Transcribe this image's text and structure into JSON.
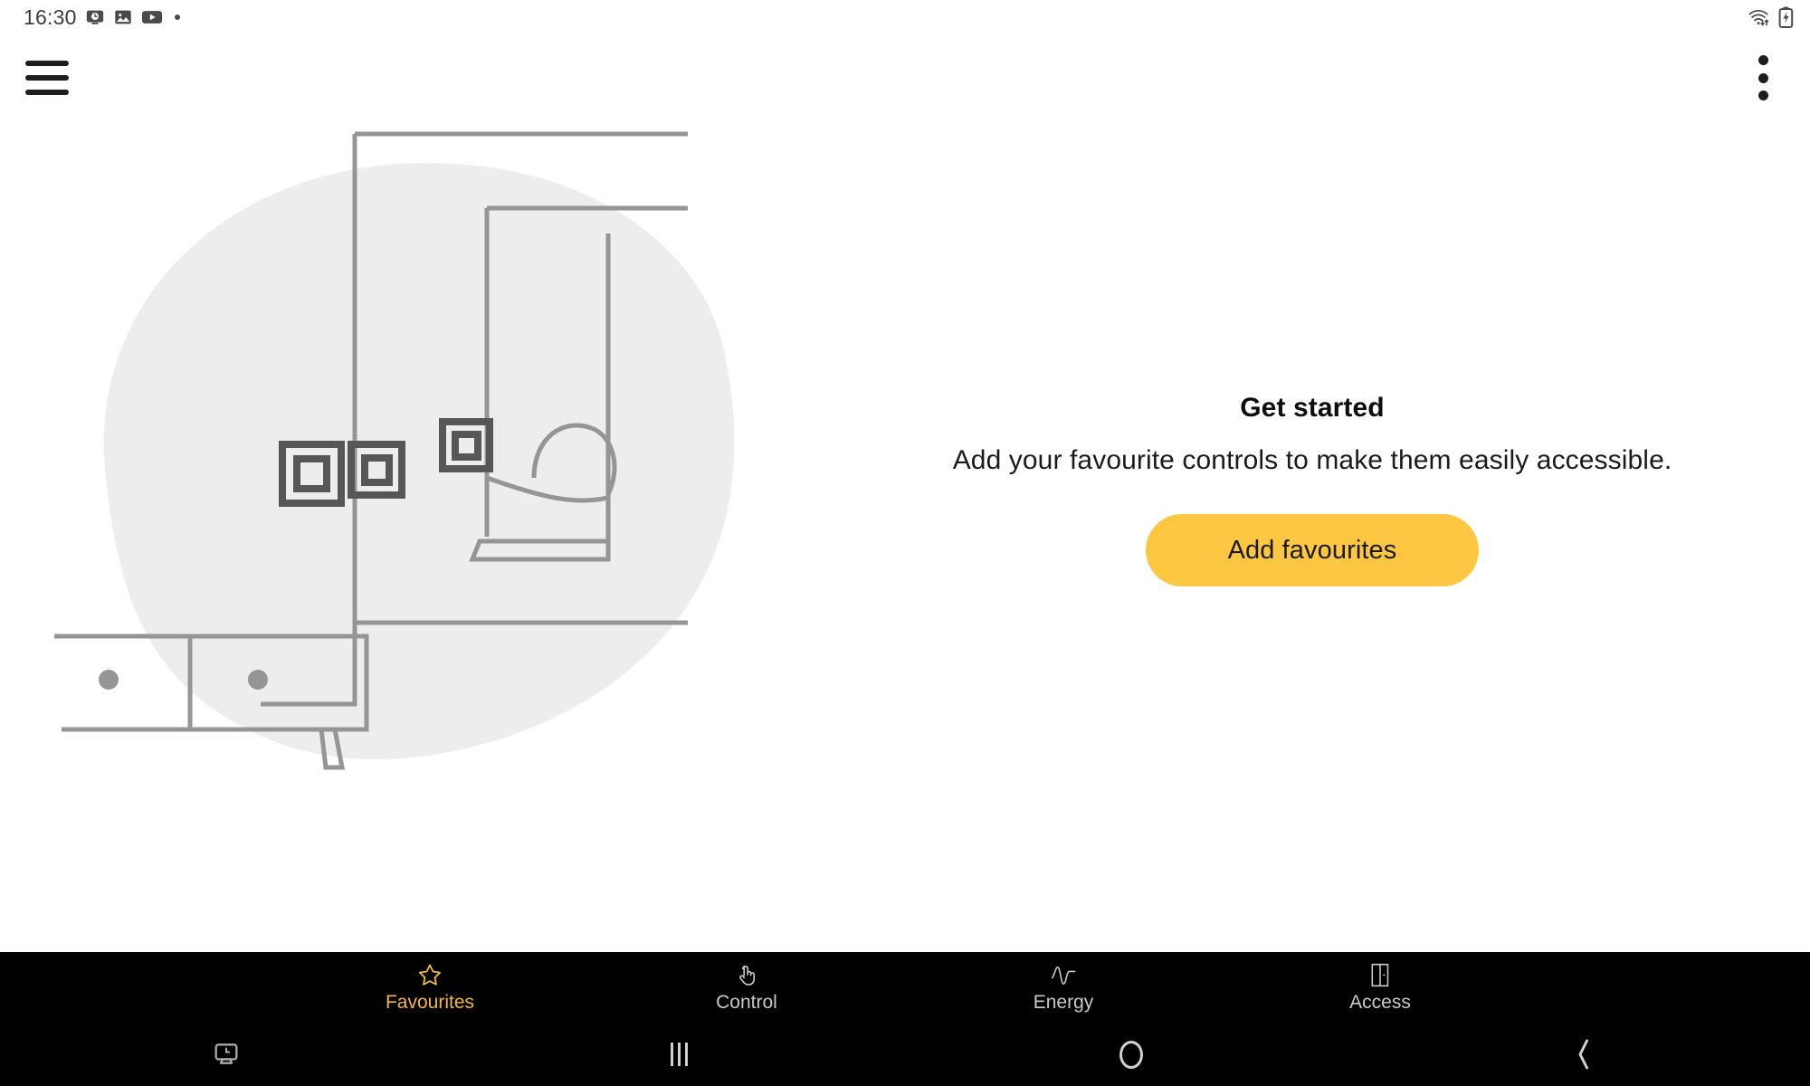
{
  "status_bar": {
    "clock": "16:30",
    "left_icons": [
      {
        "name": "screen-recorder-icon",
        "glyph": "screen-clock"
      },
      {
        "name": "gallery-icon",
        "glyph": "image"
      },
      {
        "name": "youtube-icon",
        "glyph": "play"
      },
      {
        "name": "more-notifications-dot",
        "glyph": "dot"
      }
    ],
    "right_icons": [
      {
        "name": "wifi-transfer-icon",
        "glyph": "wifi-arrows"
      },
      {
        "name": "battery-charging-icon",
        "glyph": "battery-bolt"
      }
    ]
  },
  "app_bar": {
    "menu_label": "Menu",
    "overflow_label": "More options"
  },
  "illustration": {
    "name": "empty-favourites-room-illustration",
    "description": "Line-art room with wall switches, a window showing sun over hills, and a sideboard",
    "blob_color": "#ededed",
    "line_color": "#959595",
    "switch_color": "#575757"
  },
  "main": {
    "title": "Get started",
    "subtitle": "Add your favourite controls to make them easily accessible.",
    "button_label": "Add favourites",
    "button_color": "#fdc741",
    "button_text_color": "#1a1a1a"
  },
  "bottom_nav": {
    "active_color": "#f2b93b",
    "inactive_color": "#c9c9c9",
    "items": [
      {
        "label": "Favourites",
        "icon": "star-icon",
        "active": true
      },
      {
        "label": "Control",
        "icon": "hand-tap-icon",
        "active": false
      },
      {
        "label": "Energy",
        "icon": "pulse-wave-icon",
        "active": false
      },
      {
        "label": "Access",
        "icon": "door-icon",
        "active": false
      }
    ]
  },
  "system_nav": {
    "items": [
      {
        "label": "Screen capture",
        "icon": "screen-clock-icon"
      },
      {
        "label": "Recents",
        "icon": "recents-icon"
      },
      {
        "label": "Home",
        "icon": "home-icon"
      },
      {
        "label": "Back",
        "icon": "back-chevron-icon"
      }
    ]
  }
}
